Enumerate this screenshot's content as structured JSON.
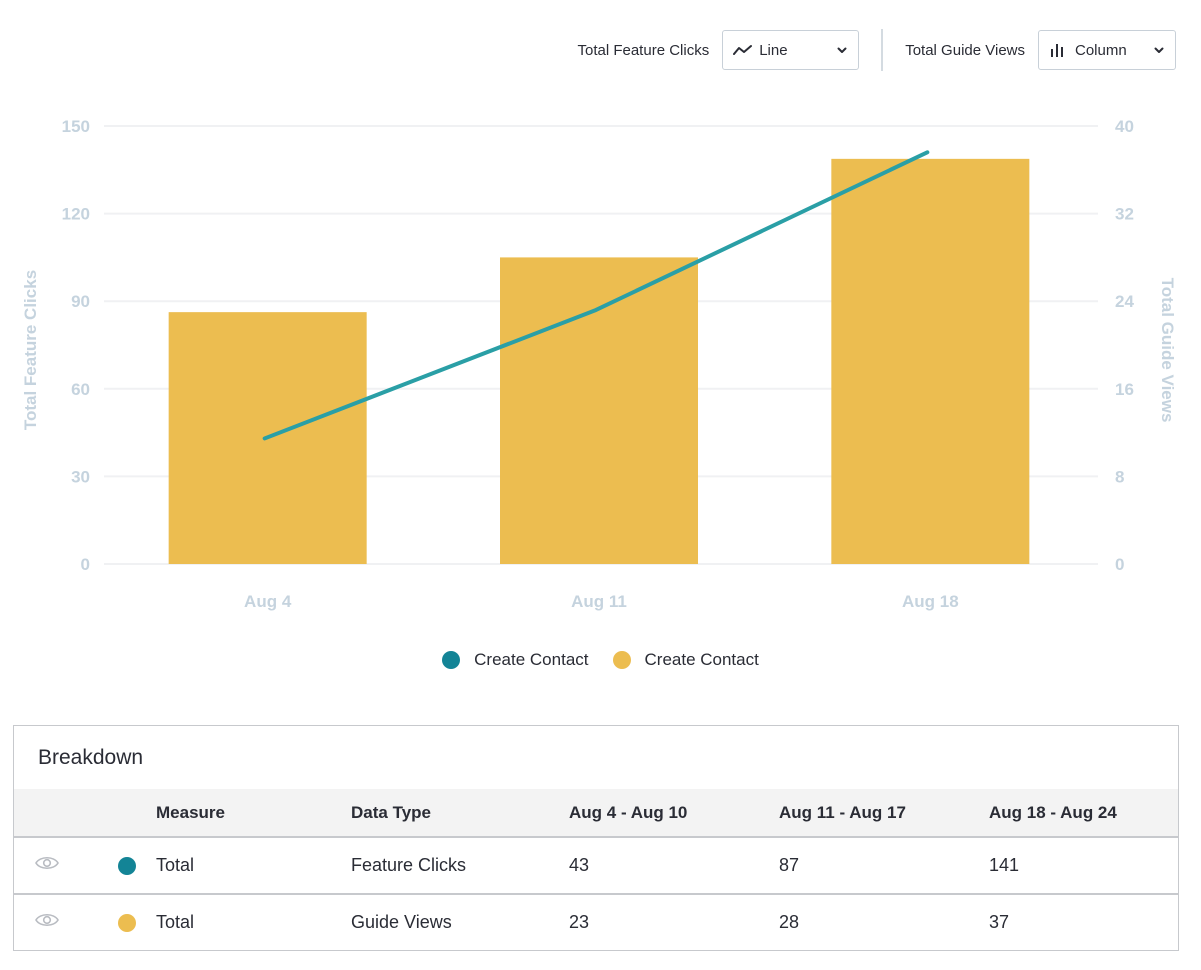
{
  "toolbar": {
    "feature_clicks_label": "Total Feature Clicks",
    "feature_clicks_type": "Line",
    "feature_clicks_icon": "line-chart-icon",
    "guide_views_label": "Total Guide Views",
    "guide_views_type": "Column",
    "guide_views_icon": "column-chart-icon"
  },
  "colors": {
    "line": "#2a9fa6",
    "bar": "#ecbd50",
    "teal_dot": "#138496",
    "axis_text": "#c5d3de",
    "grid": "#f0f1f3"
  },
  "chart_data": {
    "type": "bar+line",
    "title": "",
    "categories": [
      "Aug 4",
      "Aug 11",
      "Aug 18"
    ],
    "series": [
      {
        "name": "Create Contact",
        "type": "line",
        "axis": "left",
        "measure": "Total Feature Clicks",
        "values": [
          43,
          87,
          141
        ]
      },
      {
        "name": "Create Contact",
        "type": "bar",
        "axis": "right",
        "measure": "Total Guide Views",
        "values": [
          23,
          28,
          37
        ]
      }
    ],
    "ylabel_left": "Total Feature Clicks",
    "ylabel_right": "Total Guide Views",
    "ylim_left": [
      0,
      150
    ],
    "ylim_right": [
      0,
      40
    ],
    "yticks_left": [
      "0",
      "30",
      "60",
      "90",
      "120",
      "150"
    ],
    "yticks_right": [
      "0",
      "8",
      "16",
      "24",
      "32",
      "40"
    ],
    "grid": true,
    "legend_position": "bottom"
  },
  "legend": [
    {
      "label": "Create Contact",
      "color": "#138496"
    },
    {
      "label": "Create Contact",
      "color": "#ecbd50"
    }
  ],
  "breakdown": {
    "title": "Breakdown",
    "headers": [
      "",
      "",
      "Measure",
      "Data Type",
      "Aug 4 - Aug 10",
      "Aug 11 - Aug 17",
      "Aug 18 - Aug 24"
    ],
    "rows": [
      {
        "color": "#138496",
        "measure": "Total",
        "data_type": "Feature Clicks",
        "values": [
          "43",
          "87",
          "141"
        ]
      },
      {
        "color": "#ecbd50",
        "measure": "Total",
        "data_type": "Guide Views",
        "values": [
          "23",
          "28",
          "37"
        ]
      }
    ]
  }
}
